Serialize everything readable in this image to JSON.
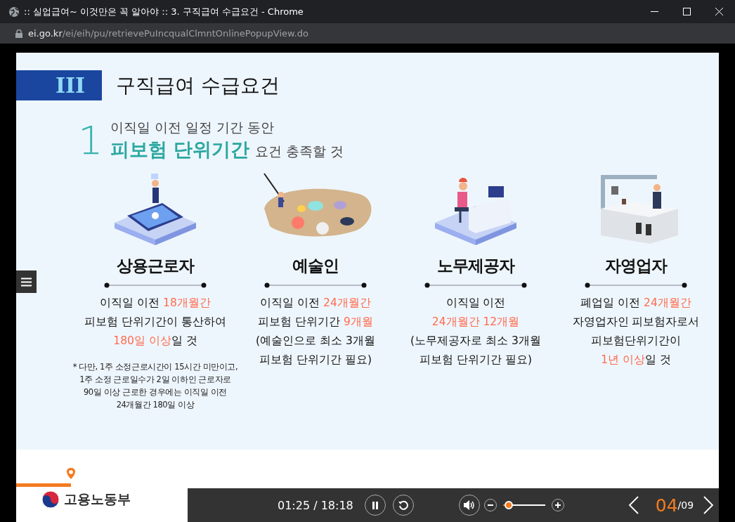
{
  "window": {
    "title": ":: 실업급여~ 이것만은 꼭 알아야 :: 3. 구직급여 수급요건 - Chrome"
  },
  "address_bar": {
    "host": "ei.go.kr",
    "path": "/ei/eih/pu/retrievePuIncqualClmntOnlinePopupView.do"
  },
  "slide": {
    "section_number": "III",
    "title": "구직급여 수급요건",
    "point": {
      "number": "1",
      "line_1": "이직일 이전 일정 기간 동안",
      "emphasis": "피보험 단위기간",
      "line_2_rest": "요건 충족할 것"
    },
    "groups": [
      {
        "kind": "phone",
        "heading": "상용근로자",
        "lines": [
          [
            {
              "text": "이직일 이전 ",
              "highlight": false
            },
            {
              "text": "18개월간",
              "highlight": true
            }
          ],
          [
            {
              "text": "피보험 단위기간이 통산하여",
              "highlight": false
            }
          ],
          [
            {
              "text": "180일 이상",
              "highlight": true
            },
            {
              "text": "일 것",
              "highlight": false
            }
          ]
        ],
        "note": [
          "* 다만, 1주 소정근로시간이 15시간 미만이고,",
          "1주 소정 근로일수가 2일 이하인 근로자로",
          "90일 이상 근로한 경우에는 이직일 이전",
          "24개월간 180일 이상"
        ]
      },
      {
        "kind": "palette",
        "heading": "예술인",
        "lines": [
          [
            {
              "text": "이직일 이전 ",
              "highlight": false
            },
            {
              "text": "24개월간",
              "highlight": true
            }
          ],
          [
            {
              "text": "피보험 단위기간 ",
              "highlight": false
            },
            {
              "text": "9개월",
              "highlight": true
            }
          ],
          [
            {
              "text": "(예술인으로 최소 3개월",
              "highlight": false
            }
          ],
          [
            {
              "text": "피보험 단위기간 필요)",
              "highlight": false
            }
          ]
        ]
      },
      {
        "kind": "desk",
        "heading": "노무제공자",
        "lines": [
          [
            {
              "text": "이직일 이전",
              "highlight": false
            }
          ],
          [
            {
              "text": "24개월간 12개월",
              "highlight": true
            }
          ],
          [
            {
              "text": "(노무제공자로 최소 3개월",
              "highlight": false
            }
          ],
          [
            {
              "text": "피보험 단위기간 필요)",
              "highlight": false
            }
          ]
        ]
      },
      {
        "kind": "cafe",
        "heading": "자영업자",
        "lines": [
          [
            {
              "text": "폐업일 이전 ",
              "highlight": false
            },
            {
              "text": "24개월간",
              "highlight": true
            }
          ],
          [
            {
              "text": "자영업자인 피보험자로서",
              "highlight": false
            }
          ],
          [
            {
              "text": "피보험단위기간이",
              "highlight": false
            }
          ],
          [
            {
              "text": "1년 이상",
              "highlight": true
            },
            {
              "text": "일 것",
              "highlight": false
            }
          ]
        ]
      }
    ]
  },
  "footer": {
    "logo_text": "고용노동부"
  },
  "player": {
    "elapsed": "01:25",
    "separator": " / ",
    "duration": "18:18",
    "playing": true,
    "volume": {
      "level": 0.1
    },
    "current_page": "04",
    "total_pages": "/09"
  }
}
